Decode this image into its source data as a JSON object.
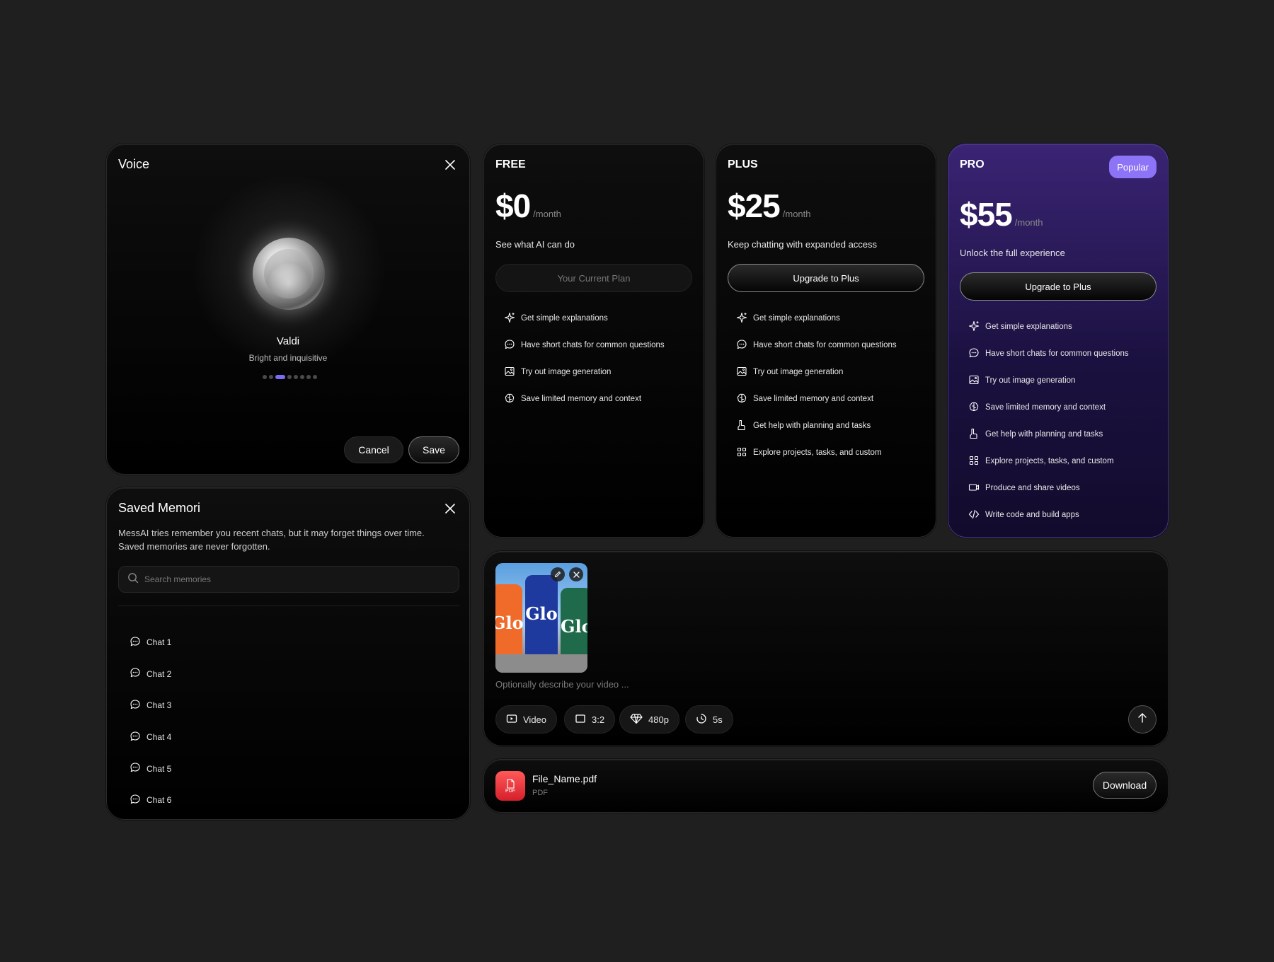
{
  "voice": {
    "title": "Voice",
    "name": "Valdi",
    "description": "Bright and inquisitive",
    "dots_total": 8,
    "dots_active_index": 2,
    "cancel_label": "Cancel",
    "save_label": "Save"
  },
  "memori": {
    "title": "Saved Memori",
    "description": "MessAI tries remember you recent chats, but it may forget things over time. Saved memories are never forgotten.",
    "search_placeholder": "Search memories",
    "chats": [
      "Chat 1",
      "Chat 2",
      "Chat 3",
      "Chat 4",
      "Chat 5",
      "Chat 6"
    ]
  },
  "plans": {
    "free": {
      "name": "FREE",
      "price": "$0",
      "period": "/month",
      "tagline": "See what AI can do",
      "button": "Your Current Plan",
      "features": [
        {
          "icon": "sparkle-icon",
          "text": "Get simple explanations"
        },
        {
          "icon": "chat-bubble-icon",
          "text": "Have short chats for common questions"
        },
        {
          "icon": "image-icon",
          "text": "Try out image generation"
        },
        {
          "icon": "brain-icon",
          "text": "Save limited memory and context"
        }
      ]
    },
    "plus": {
      "name": "PLUS",
      "price": "$25",
      "period": "/month",
      "tagline": "Keep chatting with expanded access",
      "button": "Upgrade to Plus",
      "features": [
        {
          "icon": "sparkle-icon",
          "text": "Get simple explanations"
        },
        {
          "icon": "chat-bubble-icon",
          "text": "Have short chats for common questions"
        },
        {
          "icon": "image-icon",
          "text": "Try out image generation"
        },
        {
          "icon": "brain-icon",
          "text": "Save limited memory and context"
        },
        {
          "icon": "clipboard-icon",
          "text": "Get help with planning and tasks"
        },
        {
          "icon": "grid-icon",
          "text": "Explore projects, tasks, and custom"
        }
      ]
    },
    "pro": {
      "name": "PRO",
      "badge": "Popular",
      "price": "$55",
      "period": "/month",
      "tagline": "Unlock the full experience",
      "button": "Upgrade to Plus",
      "features": [
        {
          "icon": "sparkle-icon",
          "text": "Get simple explanations"
        },
        {
          "icon": "chat-bubble-icon",
          "text": "Have short chats for common questions"
        },
        {
          "icon": "image-icon",
          "text": "Try out image generation"
        },
        {
          "icon": "brain-icon",
          "text": "Save limited memory and context"
        },
        {
          "icon": "clipboard-icon",
          "text": "Get help with planning and tasks"
        },
        {
          "icon": "grid-icon",
          "text": "Explore projects, tasks, and custom"
        },
        {
          "icon": "video-icon",
          "text": "Produce and share videos"
        },
        {
          "icon": "code-icon",
          "text": "Write code and build apps"
        }
      ]
    }
  },
  "composer": {
    "placeholder": "Optionally describe your video ...",
    "thumb_text": "Glo",
    "chips": {
      "mode": "Video",
      "ratio": "3:2",
      "resolution": "480p",
      "duration": "5s"
    }
  },
  "file": {
    "name": "File_Name.pdf",
    "type": "PDF",
    "icon_label": "PDF",
    "download_label": "Download"
  },
  "colors": {
    "accent": "#8d74f7",
    "pro_card": "#2a1a5e",
    "pdf_red": "#e53535"
  }
}
